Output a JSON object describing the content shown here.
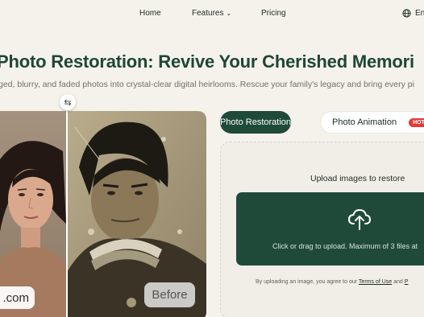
{
  "nav": {
    "home": "Home",
    "features": "Features",
    "pricing": "Pricing",
    "language": "En"
  },
  "hero": {
    "title": "Photo Restoration: Revive Your Cherished Memori",
    "subtitle": "ged, blurry, and faded photos into crystal-clear digital heirlooms. Rescue your family's legacy and bring every pi"
  },
  "compare": {
    "after_badge": ".com",
    "before_badge": "Before",
    "handle_glyph": "⇆"
  },
  "tabs": {
    "active": "Photo Restoration",
    "inactive": "Photo Animation",
    "hot": "HOT"
  },
  "upload": {
    "title": "Upload images to restore",
    "drop_text": "Click or drag to upload. Maximum of 3 files at",
    "terms_prefix": "By uploading an image, you agree to our",
    "terms_link": "Terms of Use",
    "terms_and": "and",
    "terms_more": "P"
  },
  "colors": {
    "brand": "#1f4a3a",
    "hot": "#e23a3a",
    "background": "#f5f2ec"
  },
  "icons": {
    "language": "globe-icon",
    "features_chevron": "chevron-down-icon",
    "upload": "cloud-upload-icon",
    "compare_handle": "swap-arrows-icon"
  }
}
